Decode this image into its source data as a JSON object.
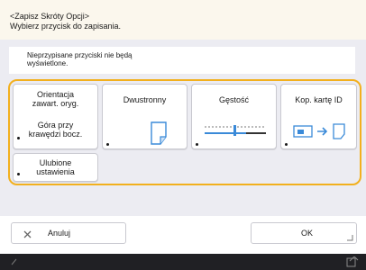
{
  "header": {
    "line1": "<Zapisz Skróty Opcji>",
    "line2": "Wybierz przycisk do zapisania."
  },
  "notice": {
    "line1": "Nieprzypisane przyciski nie będą",
    "line2": "wyświetlone."
  },
  "buttons": [
    {
      "label1": "Orientacja",
      "label2": "zawart. oryg.",
      "label3": "Góra przy",
      "label4": "krawędzi bocz."
    },
    {
      "label": "Dwustronny",
      "icon": "duplex-page-icon"
    },
    {
      "label": "Gęstość",
      "icon": "density-slider-icon"
    },
    {
      "label": "Kop. kartę ID",
      "icon": "id-card-copy-icon"
    },
    {
      "label1": "Ulubione",
      "label2": "ustawienia"
    }
  ],
  "footer": {
    "cancel": "Anuluj",
    "ok": "OK"
  },
  "colors": {
    "accent": "#f2b01e",
    "icon_blue": "#3a8ad8"
  }
}
